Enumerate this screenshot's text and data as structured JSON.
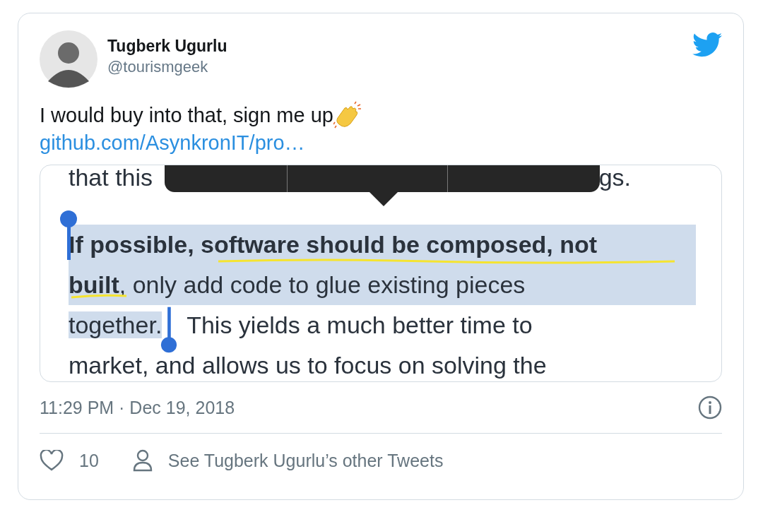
{
  "author": {
    "name": "Tugberk Ugurlu",
    "handle": "@tourismgeek"
  },
  "tweet": {
    "text": "I would buy into that, sign me up",
    "link": "github.com/AsynkronIT/pro…"
  },
  "screenshot": {
    "lines": [
      {
        "kind": "covered",
        "segments": [
          {
            "text": "that this",
            "selected": false
          },
          {
            "text": "gs.",
            "selected": false
          }
        ]
      },
      {
        "kind": "gap"
      },
      {
        "kind": "text",
        "segments": [
          {
            "text": "**If possible, software should be composed, not**",
            "selected": true
          }
        ]
      },
      {
        "kind": "text",
        "segments": [
          {
            "text": "**built**, only add code to glue existing pieces",
            "selected": true
          }
        ]
      },
      {
        "kind": "text",
        "segments": [
          {
            "text": "together.",
            "selected": true
          },
          {
            "text": " This yields a much better time to",
            "selected": false
          }
        ]
      },
      {
        "kind": "text",
        "segments": [
          {
            "text": "market, and allows us to focus on solving the",
            "selected": false
          }
        ]
      }
    ]
  },
  "timestamp": "11:29 PM · Dec 19, 2018",
  "likes": "10",
  "profile_link": "See Tugberk Ugurlu’s other Tweets"
}
